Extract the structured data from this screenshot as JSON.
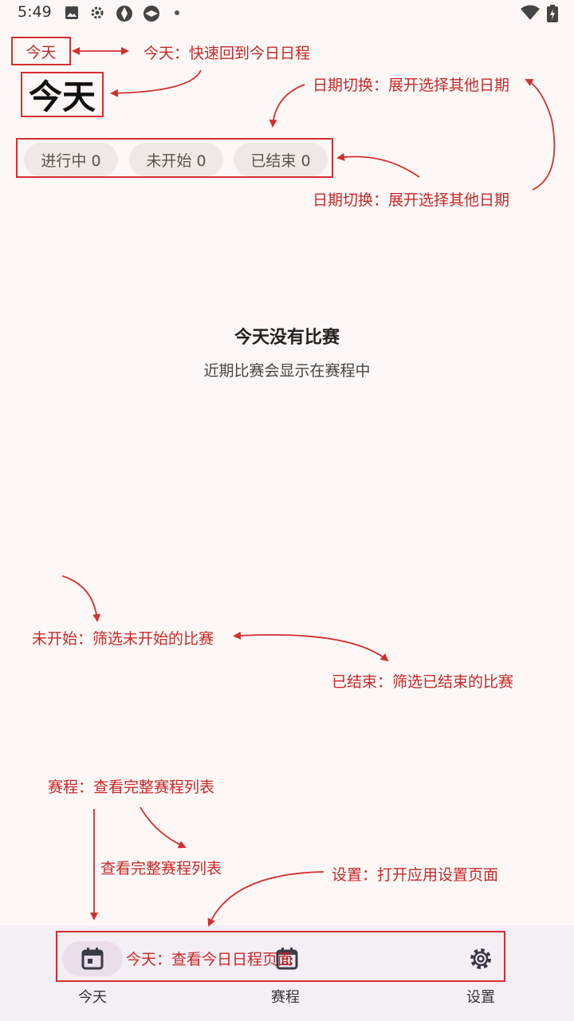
{
  "status_bar": {
    "time": "5:49",
    "icons_left": [
      "image-icon",
      "gear-icon",
      "aperture-icon",
      "aperture-icon",
      "dot-icon"
    ],
    "icons_right": [
      "wifi-icon",
      "battery-charging-icon"
    ]
  },
  "header": {
    "today_button": "今天",
    "title": "今天"
  },
  "chips": [
    {
      "label": "进行中 0"
    },
    {
      "label": "未开始 0"
    },
    {
      "label": "已结束 0"
    }
  ],
  "empty_state": {
    "title": "今天没有比赛",
    "subtitle": "近期比赛会显示在赛程中"
  },
  "annotations": {
    "today_quick": "今天：快速回到今日日程",
    "date_switch_1": "日期切换：展开选择其他日期",
    "date_switch_2": "日期切换：展开选择其他日期",
    "not_started": "未开始：筛选未开始的比赛",
    "finished": "已结束：筛选已结束的比赛",
    "schedule": "赛程：查看完整赛程列表",
    "schedule_full": "查看完整赛程列表",
    "settings": "设置：打开应用设置页面",
    "today_nav": "今天：查看今日日程页面"
  },
  "bottom_nav": {
    "items": [
      {
        "label": "今天",
        "icon": "calendar-today-icon",
        "selected": true
      },
      {
        "label": "赛程",
        "icon": "calendar-schedule-icon",
        "selected": false
      },
      {
        "label": "设置",
        "icon": "settings-gear-icon",
        "selected": false
      }
    ]
  },
  "colors": {
    "background": "#fdf8f6",
    "annotation_red": "#d32f2f",
    "chip_bg": "#eee8e6",
    "nav_bg": "#f4eef5"
  }
}
